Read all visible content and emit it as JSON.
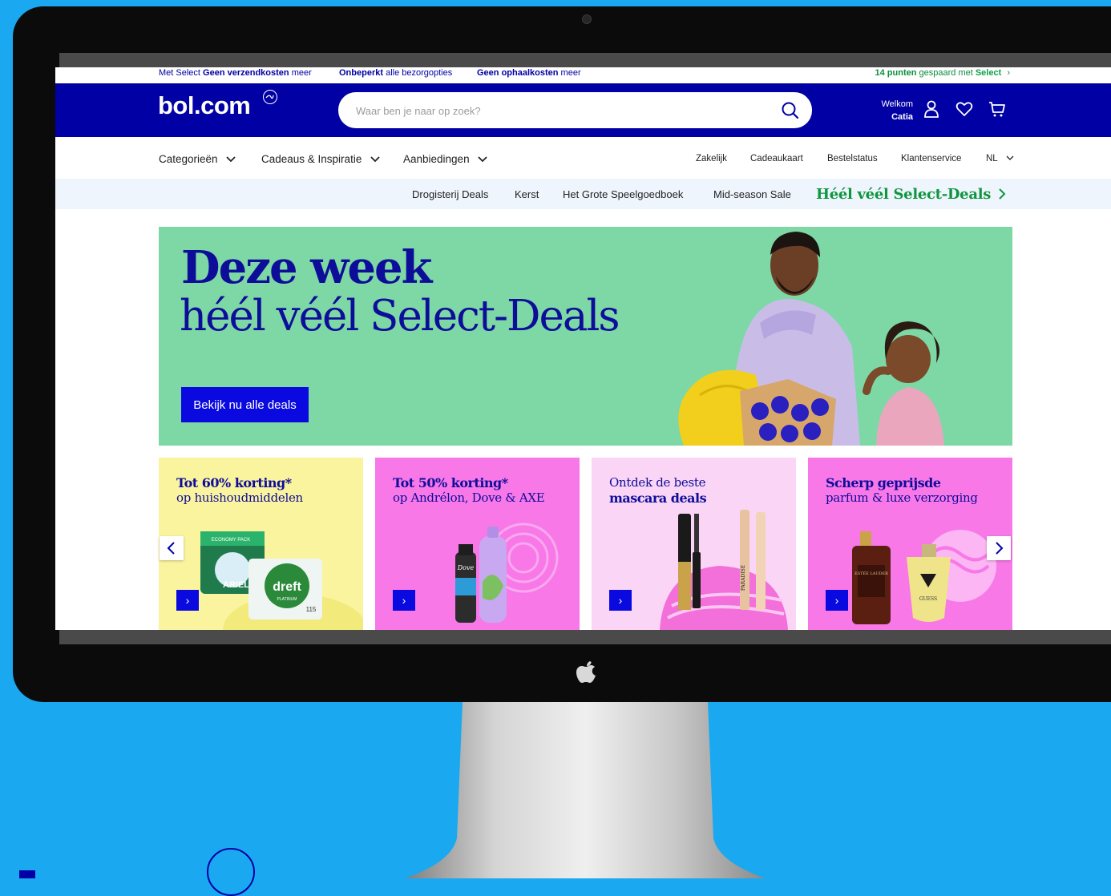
{
  "topbar": {
    "select_prefix": "Met Select",
    "free_shipping_bold": "Geen verzendkosten",
    "free_shipping_rest": "meer",
    "delivery_bold": "Onbeperkt",
    "delivery_rest": "alle bezorgopties",
    "pickup_bold": "Geen ophaalkosten",
    "pickup_rest": "meer",
    "points_bold": "14 punten",
    "points_rest": "gespaard met",
    "points_select": "Select",
    "points_chevron": "›"
  },
  "header": {
    "logo": "bol.com",
    "search_placeholder": "Waar ben je naar op zoek?",
    "welcome_label": "Welkom",
    "user_name": "Catia",
    "brand_color": "#0000a4"
  },
  "nav": {
    "categories": "Categorieën",
    "gifts": "Cadeaus & Inspiratie",
    "offers": "Aanbiedingen",
    "business": "Zakelijk",
    "gift_card": "Cadeaukaart",
    "order_status": "Bestelstatus",
    "customer_service": "Klantenservice",
    "language": "NL"
  },
  "subnav": {
    "items": [
      "Drogisterij Deals",
      "Kerst",
      "Het Grote Speelgoedboek",
      "Mid-season Sale"
    ],
    "select_deals": "Héél véél Select-Deals",
    "select_color": "#10953f"
  },
  "hero": {
    "title_line1": "Deze week",
    "title_line2": "héél véél Select-Deals",
    "button": "Bekijk nu alle deals",
    "background": "#7dd8a5"
  },
  "cards": [
    {
      "line1": "Tot 60% korting*",
      "line2": "op huishoudmiddelen",
      "bg": "#fbf49e",
      "arrow": "›"
    },
    {
      "line1": "Tot 50% korting*",
      "line2": "op Andrélon, Dove & AXE",
      "bg": "#f878e8",
      "arrow": "›"
    },
    {
      "line1_light": "Ontdek de beste",
      "line2_bold": "mascara deals",
      "bg": "#fbd5f6",
      "arrow": "›"
    },
    {
      "line1": "Scherp geprijsde",
      "line2": "parfum & luxe verzorging",
      "bg": "#f878e8",
      "arrow": "›"
    }
  ],
  "product_labels": {
    "ariel": "ARIEL",
    "ariel_pack": "ECONOMY PACK",
    "dreft": "dreft",
    "dreft_sub": "PLATINUM",
    "dreft_count": "115",
    "dove": "Dove",
    "mascara_brand": "PARADISE",
    "estee": "ESTÉE LAUDER",
    "guess": "GUESS"
  }
}
